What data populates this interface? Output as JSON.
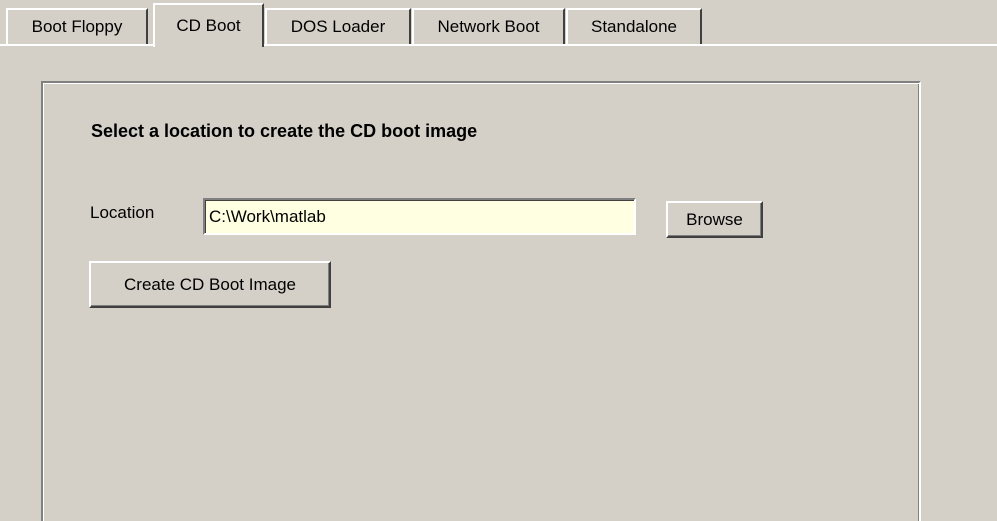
{
  "tabs": [
    {
      "label": "Boot Floppy",
      "active": false
    },
    {
      "label": "CD Boot",
      "active": true
    },
    {
      "label": "DOS Loader",
      "active": false
    },
    {
      "label": "Network Boot",
      "active": false
    },
    {
      "label": "Standalone",
      "active": false
    }
  ],
  "panel": {
    "heading": "Select a location to create the CD boot image",
    "location_label": "Location",
    "location_value": "C:\\Work\\matlab",
    "browse_label": "Browse",
    "create_label": "Create CD Boot Image"
  },
  "colors": {
    "face": "#d4d0c8",
    "input_bg": "#ffffe1"
  }
}
